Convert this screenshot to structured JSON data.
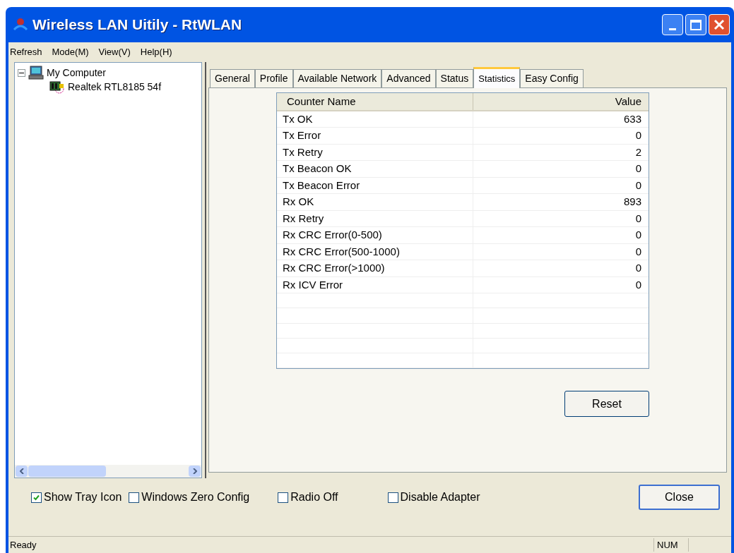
{
  "window": {
    "title": "Wireless LAN Uitily - RtWLAN"
  },
  "menu": [
    "Refresh",
    "Mode(M)",
    "View(V)",
    "Help(H)"
  ],
  "tree": [
    {
      "label": "My Computer",
      "expanded": true,
      "children": [
        {
          "label": "Realtek RTL8185 54f"
        }
      ]
    }
  ],
  "tabs": [
    {
      "label": "General",
      "selected": false
    },
    {
      "label": "Profile",
      "selected": false
    },
    {
      "label": "Available Network",
      "selected": false
    },
    {
      "label": "Advanced",
      "selected": false
    },
    {
      "label": "Status",
      "selected": false
    },
    {
      "label": "Statistics",
      "selected": true
    },
    {
      "label": "Easy Config",
      "selected": false
    }
  ],
  "table": {
    "columns": [
      "Counter Name",
      "Value"
    ],
    "rows": [
      [
        "Tx OK",
        "633"
      ],
      [
        "Tx Error",
        "0"
      ],
      [
        "Tx Retry",
        "2"
      ],
      [
        "Tx Beacon OK",
        "0"
      ],
      [
        "Tx Beacon Error",
        "0"
      ],
      [
        "Rx OK",
        "893"
      ],
      [
        "Rx Retry",
        "0"
      ],
      [
        "Rx CRC Error(0-500)",
        "0"
      ],
      [
        "Rx CRC Error(500-1000)",
        "0"
      ],
      [
        "Rx CRC Error(>1000)",
        "0"
      ],
      [
        "Rx ICV Error",
        "0"
      ]
    ]
  },
  "reset_button": "Reset",
  "options": [
    {
      "label": "Show Tray Icon",
      "checked": true
    },
    {
      "label": "Windows Zero Config",
      "checked": false
    },
    {
      "label": "Radio Off",
      "checked": false
    },
    {
      "label": "Disable Adapter",
      "checked": false
    }
  ],
  "close_button": "Close",
  "status_bar": {
    "message": "Ready",
    "indicator": "NUM"
  }
}
